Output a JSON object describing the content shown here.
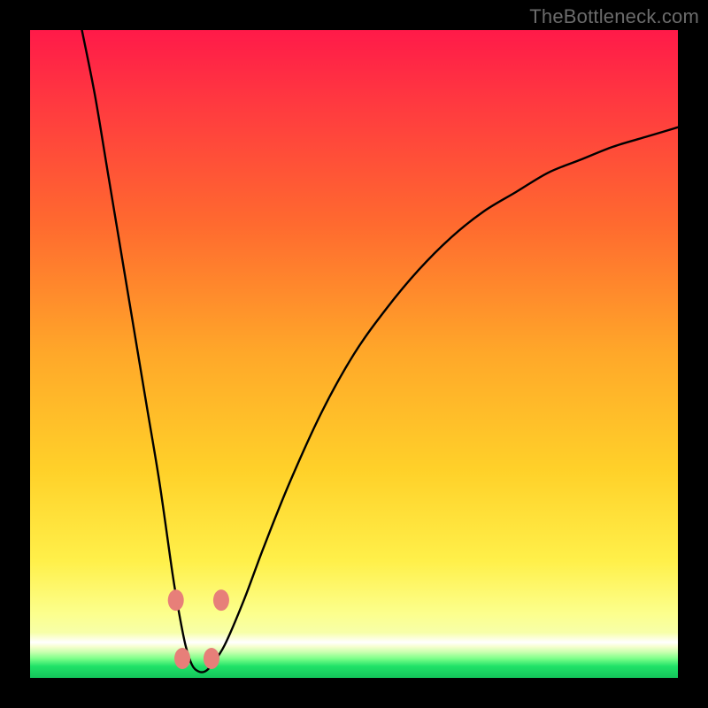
{
  "watermark": "TheBottleneck.com",
  "chart_data": {
    "type": "line",
    "title": "",
    "xlabel": "",
    "ylabel": "",
    "xlim": [
      0,
      100
    ],
    "ylim": [
      0,
      100
    ],
    "grid": false,
    "legend": false,
    "background_gradient": {
      "stops": [
        {
          "pos": 0,
          "color": "#ff1a49"
        },
        {
          "pos": 0.3,
          "color": "#ff6a2f"
        },
        {
          "pos": 0.5,
          "color": "#ffa829"
        },
        {
          "pos": 0.82,
          "color": "#fff04a"
        },
        {
          "pos": 0.945,
          "color": "#ffffff"
        },
        {
          "pos": 1.0,
          "color": "#14c45a"
        }
      ]
    },
    "series": [
      {
        "name": "bottleneck-curve",
        "color": "#000000",
        "x": [
          8,
          10,
          12,
          14,
          16,
          18,
          20,
          22,
          23,
          24,
          25,
          26,
          27,
          28,
          30,
          33,
          36,
          40,
          45,
          50,
          55,
          60,
          65,
          70,
          75,
          80,
          85,
          90,
          95,
          100
        ],
        "y": [
          100,
          90,
          78,
          66,
          54,
          42,
          30,
          16,
          10,
          5,
          2,
          1,
          1,
          2,
          5,
          12,
          20,
          30,
          41,
          50,
          57,
          63,
          68,
          72,
          75,
          78,
          80,
          82,
          83.5,
          85
        ]
      }
    ],
    "markers": [
      {
        "name": "left-upper",
        "x": 22.5,
        "y": 12,
        "color": "#e77f79"
      },
      {
        "name": "left-lower",
        "x": 23.5,
        "y": 3,
        "color": "#e77f79"
      },
      {
        "name": "right-lower",
        "x": 28.0,
        "y": 3,
        "color": "#e77f79"
      },
      {
        "name": "right-upper",
        "x": 29.5,
        "y": 12,
        "color": "#e77f79"
      }
    ]
  }
}
